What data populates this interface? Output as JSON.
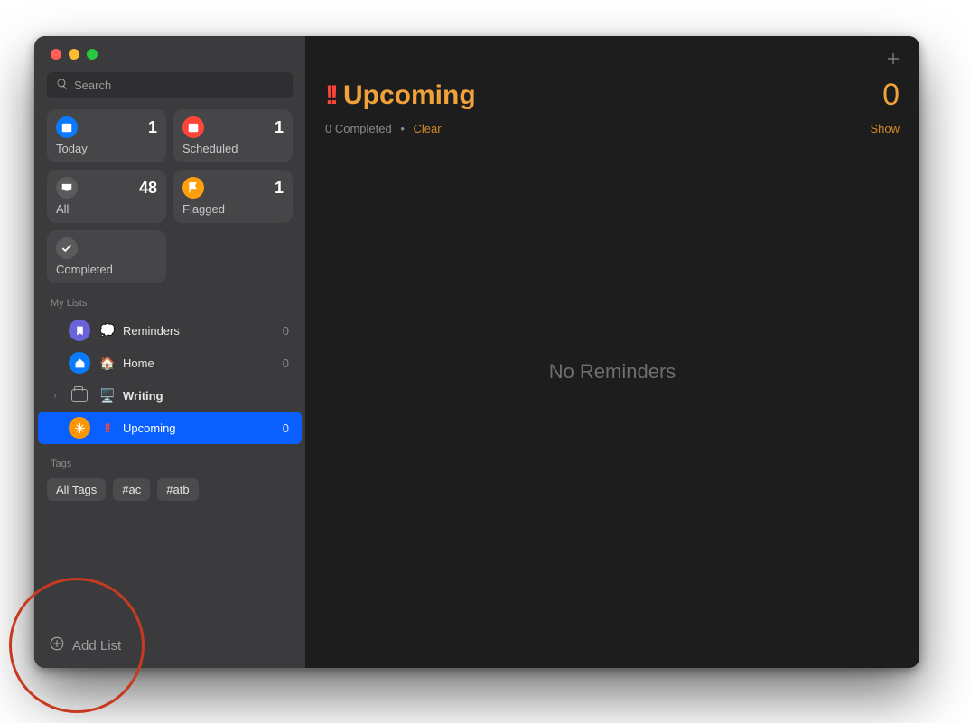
{
  "search": {
    "placeholder": "Search"
  },
  "smart": {
    "today": {
      "label": "Today",
      "count": "1"
    },
    "scheduled": {
      "label": "Scheduled",
      "count": "1"
    },
    "all": {
      "label": "All",
      "count": "48"
    },
    "flagged": {
      "label": "Flagged",
      "count": "1"
    },
    "completed": {
      "label": "Completed"
    }
  },
  "sections": {
    "mylists": "My Lists",
    "tags": "Tags"
  },
  "lists": {
    "reminders": {
      "emoji": "💭",
      "label": "Reminders",
      "count": "0"
    },
    "home": {
      "emoji": "🏠",
      "label": "Home",
      "count": "0"
    },
    "writing": {
      "emoji": "🖥️",
      "label": "Writing"
    },
    "upcoming": {
      "bang": "!!",
      "label": "Upcoming",
      "count": "0"
    }
  },
  "tags": {
    "all": "All Tags",
    "ac": "#ac",
    "atb": "#atb"
  },
  "addlist": "Add List",
  "main": {
    "bang": "!!",
    "title": "Upcoming",
    "count": "0",
    "completed_text": "0 Completed",
    "clear": "Clear",
    "show": "Show",
    "empty": "No Reminders"
  }
}
